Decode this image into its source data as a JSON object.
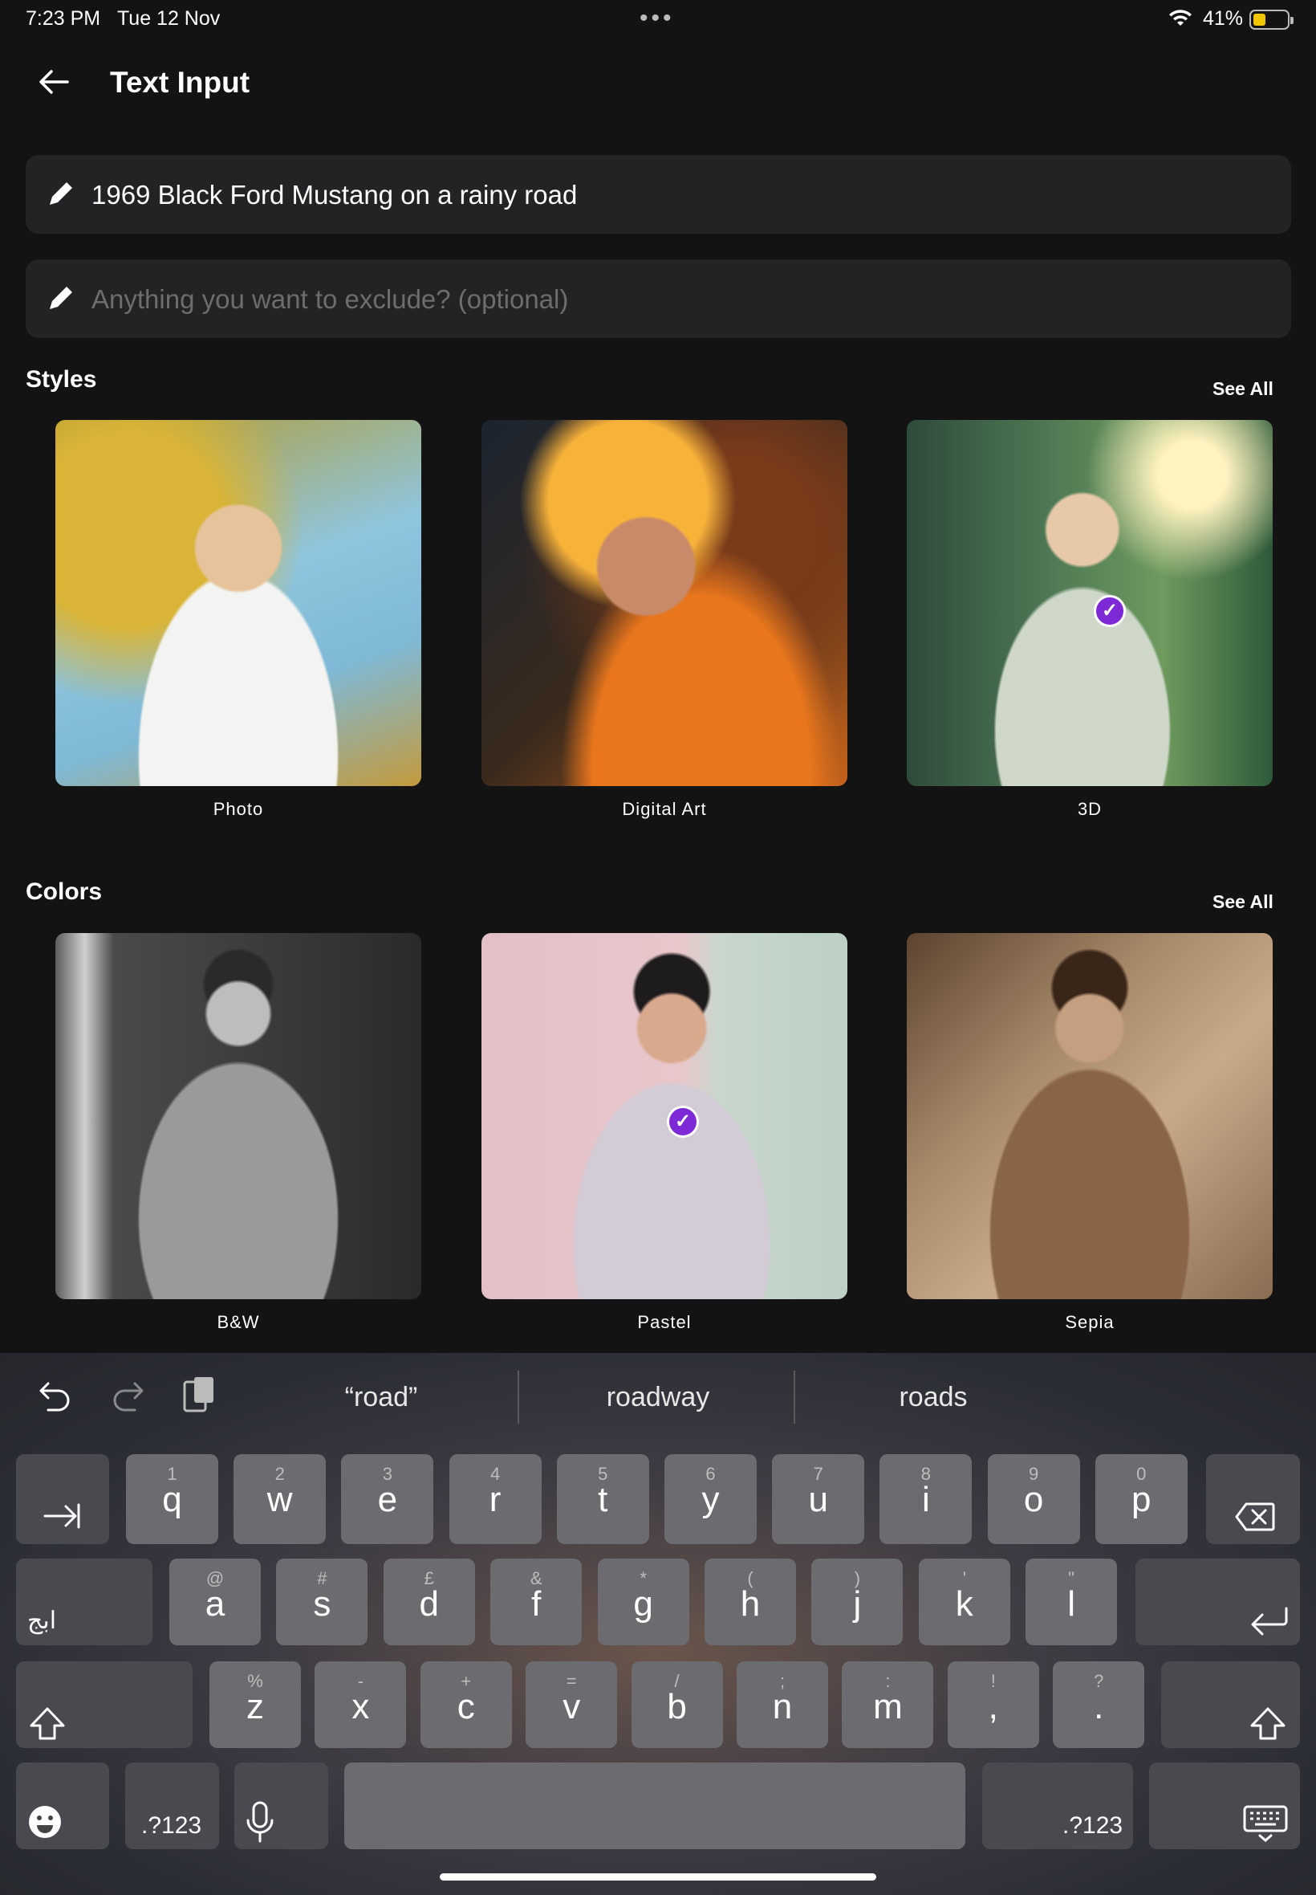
{
  "status_bar": {
    "time": "7:23 PM",
    "date": "Tue 12 Nov",
    "battery_percent": "41%",
    "battery_level": 0.41
  },
  "header": {
    "title": "Text Input",
    "back_icon": "arrow-left-icon"
  },
  "inputs": {
    "prompt_value": "1969 Black Ford Mustang on a rainy road",
    "exclude_placeholder": "Anything you want to exclude? (optional)"
  },
  "styles": {
    "title": "Styles",
    "see_all": "See All",
    "items": [
      {
        "label": "Photo",
        "selected": false
      },
      {
        "label": "Digital Art",
        "selected": false
      },
      {
        "label": "3D",
        "selected": true
      }
    ]
  },
  "colors": {
    "title": "Colors",
    "see_all": "See All",
    "items": [
      {
        "label": "B&W",
        "selected": false
      },
      {
        "label": "Pastel",
        "selected": true
      },
      {
        "label": "Sepia",
        "selected": false
      }
    ]
  },
  "keyboard": {
    "suggestions": [
      "“road”",
      "roadway",
      "roads"
    ],
    "row1": [
      [
        "1",
        "q"
      ],
      [
        "2",
        "w"
      ],
      [
        "3",
        "e"
      ],
      [
        "4",
        "r"
      ],
      [
        "5",
        "t"
      ],
      [
        "6",
        "y"
      ],
      [
        "7",
        "u"
      ],
      [
        "8",
        "i"
      ],
      [
        "9",
        "o"
      ],
      [
        "0",
        "p"
      ]
    ],
    "row2": [
      [
        "@",
        "a"
      ],
      [
        "#",
        "s"
      ],
      [
        "£",
        "d"
      ],
      [
        "&",
        "f"
      ],
      [
        "*",
        "g"
      ],
      [
        "(",
        "h"
      ],
      [
        ")",
        "j"
      ],
      [
        "'",
        "k"
      ],
      [
        "\"",
        "l"
      ]
    ],
    "row3": [
      [
        "%",
        "z"
      ],
      [
        "-",
        "x"
      ],
      [
        "+",
        "c"
      ],
      [
        "=",
        "v"
      ],
      [
        "/",
        "b"
      ],
      [
        ";",
        "n"
      ],
      [
        ":",
        "m"
      ],
      [
        "!",
        ","
      ],
      [
        "?",
        "."
      ]
    ],
    "lang_key": "ابج",
    "symbols_key": ".?123"
  },
  "accent_color": "#7d2ad6"
}
